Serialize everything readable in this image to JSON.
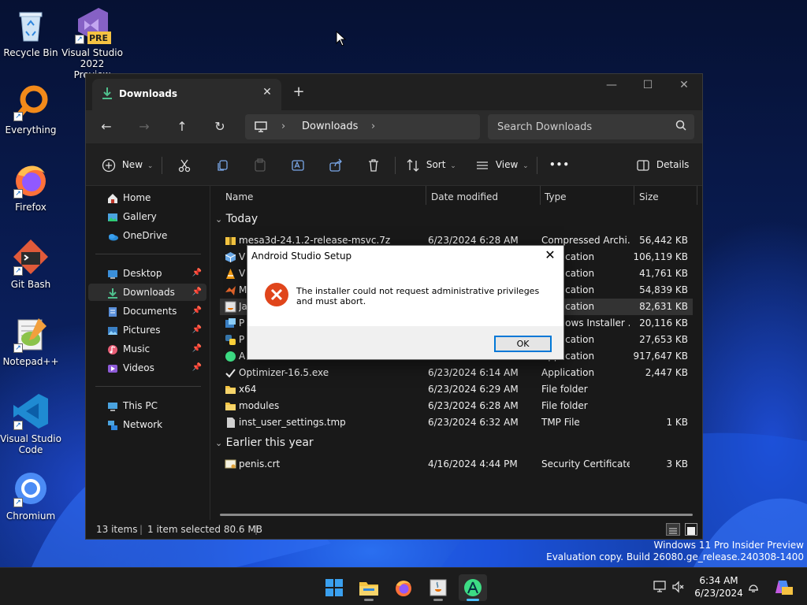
{
  "desktop": {
    "icons": [
      {
        "label_lines": [
          "Recycle Bin"
        ],
        "icon": "recycle-bin-icon"
      },
      {
        "label_lines": [
          "Visual Studio",
          "2022 Preview"
        ],
        "icon": "visual-studio-preview-icon",
        "badge": "PRE"
      },
      {
        "label_lines": [
          "Everything"
        ],
        "icon": "everything-search-icon"
      },
      {
        "label_lines": [
          "Firefox"
        ],
        "icon": "firefox-icon"
      },
      {
        "label_lines": [
          "Git Bash"
        ],
        "icon": "git-bash-icon"
      },
      {
        "label_lines": [
          "Notepad++"
        ],
        "icon": "notepad-plus-plus-icon"
      },
      {
        "label_lines": [
          "Visual Studio",
          "Code"
        ],
        "icon": "vscode-icon"
      },
      {
        "label_lines": [
          "Chromium"
        ],
        "icon": "chromium-icon"
      }
    ]
  },
  "explorer": {
    "tab_title": "Downloads",
    "tab_close": "✕",
    "new_tab": "+",
    "address": {
      "segments": [
        "Downloads"
      ]
    },
    "search": {
      "placeholder": "Search Downloads"
    },
    "toolbar": {
      "new_label": "New",
      "sort_label": "Sort",
      "view_label": "View",
      "more_label": "•••",
      "details_label": "Details"
    },
    "sidebar": {
      "items": [
        {
          "label": "Home",
          "icon": "home-icon"
        },
        {
          "label": "Gallery",
          "icon": "gallery-icon"
        },
        {
          "label": "OneDrive",
          "icon": "onedrive-icon"
        },
        {
          "label": "Desktop",
          "icon": "desktop-icon",
          "pinned": true
        },
        {
          "label": "Downloads",
          "icon": "downloads-icon",
          "pinned": true,
          "selected": true
        },
        {
          "label": "Documents",
          "icon": "documents-icon",
          "pinned": true
        },
        {
          "label": "Pictures",
          "icon": "pictures-icon",
          "pinned": true
        },
        {
          "label": "Music",
          "icon": "music-icon",
          "pinned": true
        },
        {
          "label": "Videos",
          "icon": "videos-icon",
          "pinned": true
        },
        {
          "label": "This PC",
          "icon": "this-pc-icon"
        },
        {
          "label": "Network",
          "icon": "network-icon"
        }
      ]
    },
    "columns": [
      "Name",
      "Date modified",
      "Type",
      "Size"
    ],
    "groups": {
      "today": "Today",
      "earlier": "Earlier this year"
    },
    "rows_today": [
      {
        "name": "mesa3d-24.1.2-release-msvc.7z",
        "date": "6/23/2024 6:28 AM",
        "type": "Compressed Archi...",
        "size": "56,442 KB",
        "icon": "archive-icon"
      },
      {
        "name": "V",
        "date": "",
        "type": "Application",
        "size": "106,119 KB",
        "icon": "app-installer-icon"
      },
      {
        "name": "V",
        "date": "",
        "type": "Application",
        "size": "41,761 KB",
        "icon": "vlc-icon"
      },
      {
        "name": "M",
        "date": "",
        "type": "Application",
        "size": "54,839 KB",
        "icon": "matlab-icon"
      },
      {
        "name": "Ja",
        "date": "",
        "type": "Application",
        "size": "82,631 KB",
        "icon": "java-icon",
        "selected": true
      },
      {
        "name": "P",
        "date": "",
        "type": "Windows Installer ...",
        "size": "20,116 KB",
        "icon": "msi-icon"
      },
      {
        "name": "P",
        "date": "",
        "type": "Application",
        "size": "27,653 KB",
        "icon": "python-icon"
      },
      {
        "name": "A",
        "date": "",
        "type": "Application",
        "size": "917,647 KB",
        "icon": "android-studio-icon"
      },
      {
        "name": "Optimizer-16.5.exe",
        "date": "6/23/2024 6:14 AM",
        "type": "Application",
        "size": "2,447 KB",
        "icon": "checkmark-icon"
      },
      {
        "name": "x64",
        "date": "6/23/2024 6:29 AM",
        "type": "File folder",
        "size": "",
        "icon": "folder-icon"
      },
      {
        "name": "modules",
        "date": "6/23/2024 6:28 AM",
        "type": "File folder",
        "size": "",
        "icon": "folder-icon"
      },
      {
        "name": "inst_user_settings.tmp",
        "date": "6/23/2024 6:32 AM",
        "type": "TMP File",
        "size": "1 KB",
        "icon": "file-icon"
      }
    ],
    "rows_earlier": [
      {
        "name": "penis.crt",
        "date": "4/16/2024 4:44 PM",
        "type": "Security Certificate",
        "size": "3 KB",
        "icon": "certificate-icon"
      }
    ],
    "status": {
      "items": "13 items",
      "selected": "1 item selected  80.6 MB"
    }
  },
  "dialog": {
    "title": "Android Studio Setup",
    "close": "✕",
    "message": "The installer could not request administrative privileges and must abort.",
    "ok_label": "OK"
  },
  "watermark": {
    "line1": "Windows 11 Pro Insider Preview",
    "line2": "Evaluation copy. Build 26080.ge_release.240308-1400"
  },
  "taskbar": {
    "apps": [
      {
        "icon": "windows-start-icon"
      },
      {
        "icon": "file-explorer-icon",
        "running": true
      },
      {
        "icon": "firefox-icon"
      },
      {
        "icon": "java-setup-icon",
        "running": true
      },
      {
        "icon": "android-studio-icon",
        "running": true,
        "active": true
      }
    ],
    "time": "6:34 AM",
    "date": "6/23/2024"
  },
  "colors": {
    "accent": "#0078d7",
    "error": "#e0451b",
    "folder": "#f3c340",
    "taskbar_active": "#4cc2ff"
  }
}
